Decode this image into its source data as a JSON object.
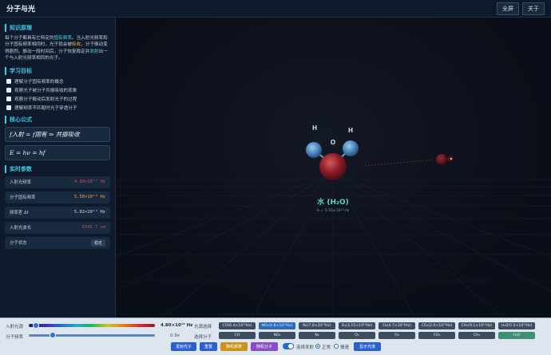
{
  "header": {
    "title": "分子与光",
    "fullscreen_label": "全屏",
    "about_label": "关于"
  },
  "sidebar": {
    "knowledge_title": "知识原理",
    "knowledge_text": {
      "p1": "每个分子都具有它特定的",
      "h1": "固有频率",
      "p2": "。当入射光频率和分子固有频率相同时，光子就会被",
      "h2": "吸收",
      "p3": "，分子振动变得剧烈。振动一段时间后，分子恢复稳定并",
      "h3": "发射",
      "p4": "出一个与入射光频率相同的光子。"
    },
    "goals_title": "学习目标",
    "goals": [
      "理解分子固有频率的概念",
      "观察光子被分子共振吸收的现象",
      "观察分子振动后发射光子的过程",
      "理解频率不匹配时光子穿透分子"
    ],
    "formula_title": "核心公式",
    "formula_1": "f入射 = f固有 ⇒ 共振吸收",
    "formula_2": "E = hν = hf",
    "realtime_title": "实时参数",
    "params": [
      {
        "label": "入射光频率",
        "value": "4.80×10¹³ Hz",
        "color": "#d54a4a"
      },
      {
        "label": "分子固有频率",
        "value": "5.50×10¹³ Hz",
        "color": "#f3a83a"
      },
      {
        "label": "频率差 Δf",
        "value": "5.02×10¹³ Hz",
        "color": "#d7dee7"
      },
      {
        "label": "入射光波长",
        "value": "6245.7 nm",
        "color": "#d54a4a"
      }
    ],
    "status_label": "分子状态",
    "status_value": "稳定"
  },
  "scene": {
    "molecule_name": "水 (H₂O)",
    "molecule_freq": "f₀ = 5.50×10¹³ Hz",
    "atom_h": "H",
    "atom_o": "O"
  },
  "controls": {
    "incident_label": "入射光源",
    "incident_value": "4.80×10¹³ Hz",
    "speed_label": "分子频率",
    "speed_value": "0.9x",
    "light_select_label": "光源选择",
    "mol_select_label": "选择分子",
    "light_options": [
      "CO(6.4×10¹³Hz)",
      "NO₂(4.8×10¹³Hz)",
      "N₂(7.0×10¹³Hz)",
      "O₂(3.15×10¹³Hz)",
      "O₃(4.7×10¹³Hz)",
      "CO₂(2.0×10¹³Hz)",
      "CH₄(9.1×10¹³Hz)",
      "H₂O(5.5×10¹³Hz)"
    ],
    "mol_options": [
      "CO",
      "NO₂",
      "N₂",
      "O₂",
      "O₃",
      "CO₂",
      "CH₄",
      "H₂O"
    ],
    "fire_label": "发射光子",
    "reset_label": "重置",
    "random_freq_label": "随机频率",
    "random_mol_label": "随机分子",
    "continuous_label": "连续发射",
    "normal_label": "正常",
    "slow_label": "慢速",
    "show_guide_label": "显示光谱"
  }
}
